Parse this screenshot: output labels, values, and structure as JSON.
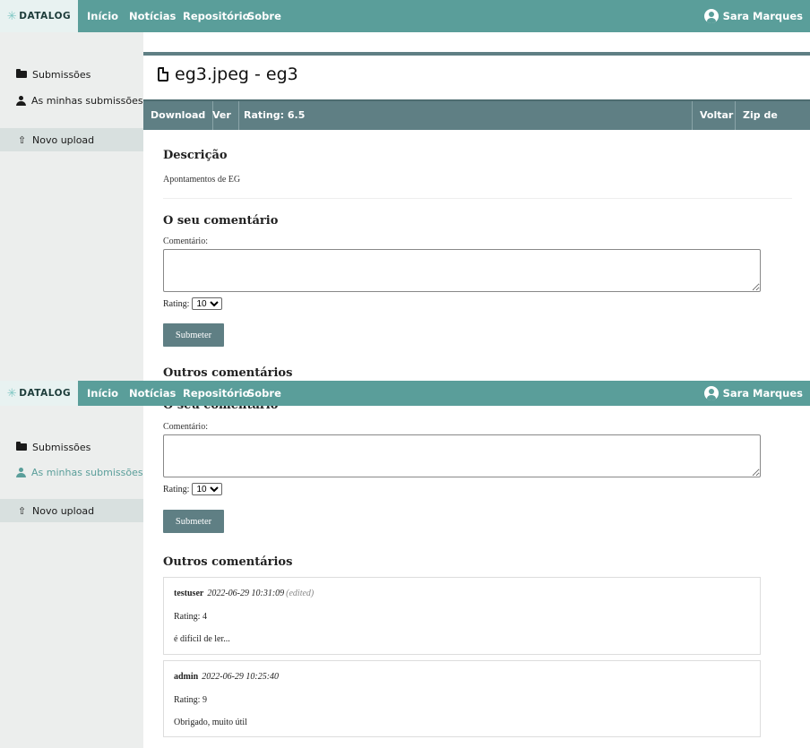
{
  "app": {
    "brand": "DATALOG",
    "accent": "#5a9e9a",
    "secondary": "#5f7f84",
    "nav": [
      "Início",
      "Notícias",
      "Repositório",
      "Sobre"
    ],
    "user": "Sara Marques"
  },
  "sidebar": {
    "items": [
      {
        "label": "Submissões",
        "icon": "folder-icon"
      },
      {
        "label": "As minhas submissões",
        "icon": "person-icon"
      },
      {
        "label": "Novo upload",
        "icon": "upload-icon"
      }
    ]
  },
  "file": {
    "title": "eg3.jpeg - eg3",
    "actions": {
      "download": "Download",
      "view": "Ver",
      "rating": "Rating: 6.5",
      "back": "Voltar",
      "zip": "Zip de Origem"
    }
  },
  "description": {
    "heading": "Descrição",
    "text": "Apontamentos de EG"
  },
  "comment_form": {
    "heading": "O seu comentário",
    "label": "Comentário:",
    "value": "",
    "rating_label": "Rating:",
    "rating_value": "10",
    "submit": "Submeter"
  },
  "comments": {
    "heading": "Outros comentários",
    "items": [
      {
        "author": "testuser",
        "date": "2022-06-29 10:31:09",
        "edited": "(edited)",
        "rating": "Rating: 4",
        "text": "é difícil de ler..."
      },
      {
        "author": "admin",
        "date": "2022-06-29 10:25:40",
        "edited": "",
        "rating": "Rating: 9",
        "text": "Obrigado, muito útil"
      }
    ]
  }
}
